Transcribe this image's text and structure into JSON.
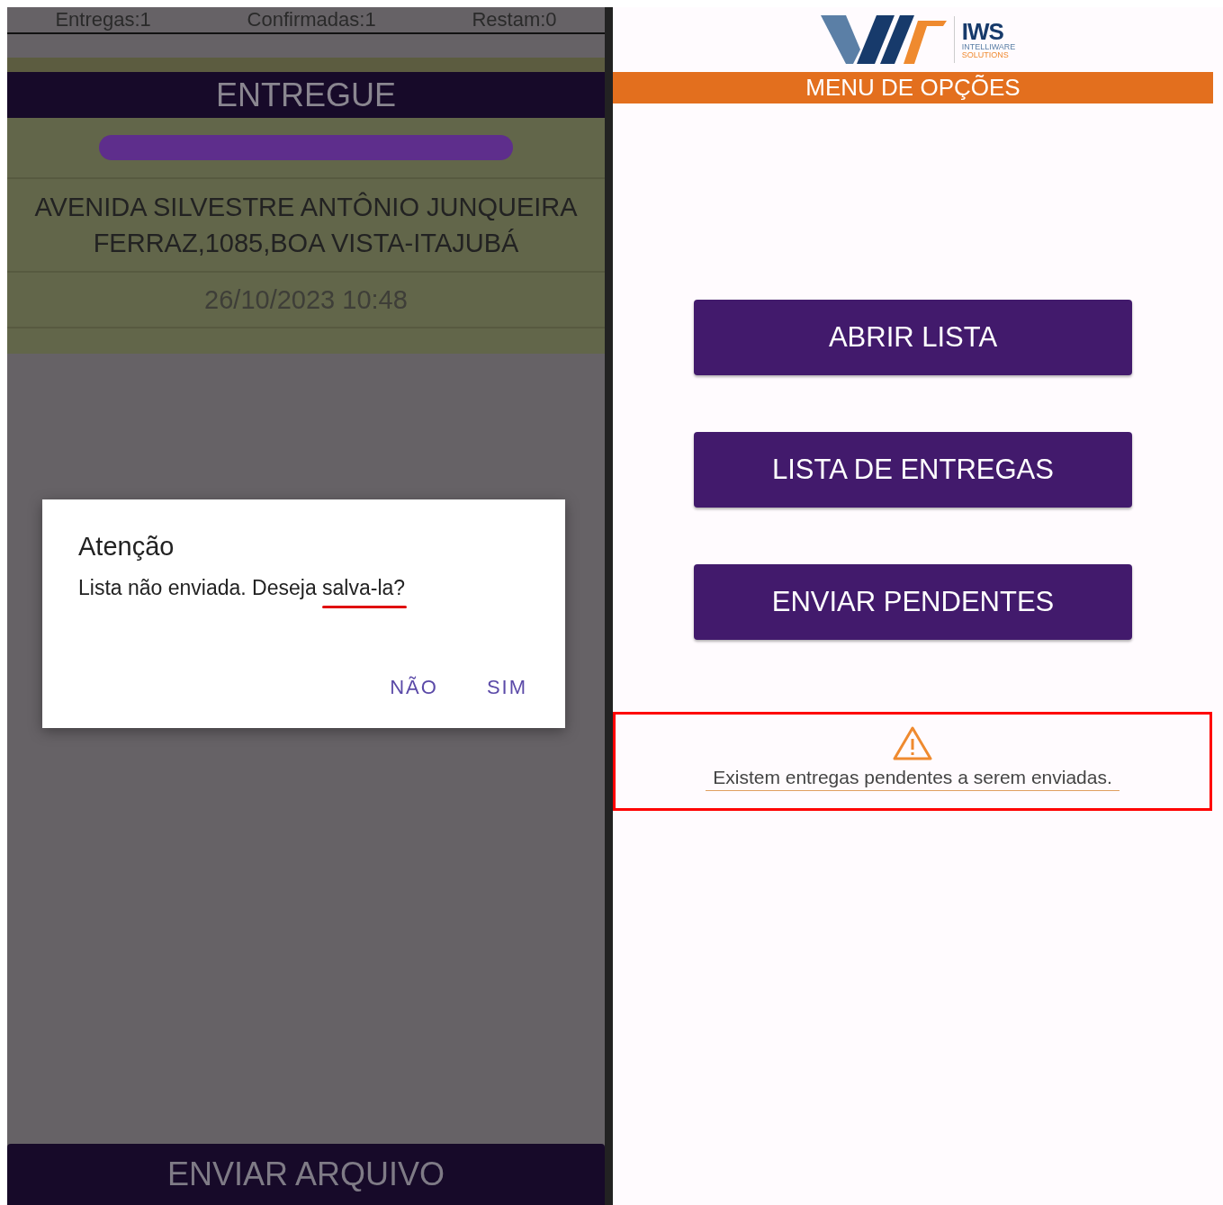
{
  "left_screen": {
    "counters": [
      {
        "label": "Entregas:1"
      },
      {
        "label": "Confirmadas:1"
      },
      {
        "label": "Restam:0"
      }
    ],
    "status_banner": "ENTREGUE",
    "address": [
      "AVENIDA SILVESTRE ANTÔNIO JUNQUEIRA",
      "FERRAZ,1085,BOA VISTA-ITAJUBÁ"
    ],
    "datetime": "26/10/2023 10:48",
    "bottom_button": "ENVIAR ARQUIVO",
    "dialog": {
      "title": "Atenção",
      "message": "Lista não enviada. Deseja salva-la?",
      "buttons": [
        {
          "label": "NÃO"
        },
        {
          "label": "SIM"
        }
      ]
    }
  },
  "right_screen": {
    "logo": {
      "name": "IWS",
      "tagline": [
        "INTELLIWARE",
        "SOLUTIONS"
      ]
    },
    "header": "MENU DE OPÇÕES",
    "buttons": [
      {
        "label": "ABRIR LISTA"
      },
      {
        "label": "LISTA DE ENTREGAS"
      },
      {
        "label": "ENVIAR PENDENTES"
      }
    ],
    "warning": "Existem entregas pendentes a serem enviadas."
  }
}
